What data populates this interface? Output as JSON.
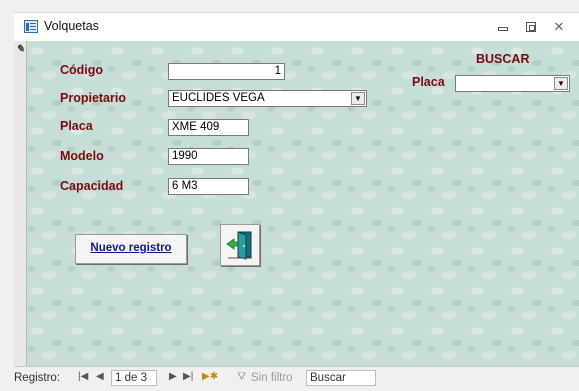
{
  "window": {
    "title": "Volquetas"
  },
  "form": {
    "codigo_label": "Código",
    "codigo_value": "1",
    "propietario_label": "Propietario",
    "propietario_value": "EUCLIDES VEGA",
    "placa_label": "Placa",
    "placa_value": "XME 409",
    "modelo_label": "Modelo",
    "modelo_value": "1990",
    "capacidad_label": "Capacidad",
    "capacidad_value": "6 M3"
  },
  "buscar": {
    "title": "BUSCAR",
    "placa_label": "Placa",
    "placa_value": ""
  },
  "buttons": {
    "nuevo_registro": "Nuevo registro",
    "exit_icon": "exit-door-icon"
  },
  "navigation": {
    "registro_label": "Registro:",
    "current": "1 de 3",
    "filter_label": "Sin filtro",
    "search_placeholder": "Buscar"
  },
  "colors": {
    "label_color": "#7a0a0a",
    "link_color": "#101a8a",
    "background": "#c7ddd7"
  }
}
